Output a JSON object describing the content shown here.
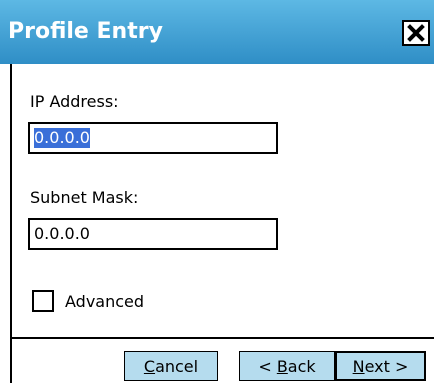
{
  "window": {
    "title": "Profile Entry",
    "close_glyph": "✕"
  },
  "form": {
    "ip_label": "IP Address:",
    "ip_value": "0.0.0.0",
    "subnet_label": "Subnet Mask:",
    "subnet_value": "0.0.0.0",
    "advanced_label": "Advanced",
    "advanced_checked": false
  },
  "buttons": {
    "cancel": {
      "pre": "",
      "mnemonic": "C",
      "post": "ancel"
    },
    "back": {
      "pre": "< ",
      "mnemonic": "B",
      "post": "ack"
    },
    "next": {
      "pre": "",
      "mnemonic": "N",
      "post": "ext >"
    }
  },
  "colors": {
    "titlebar_top": "#5db8e4",
    "titlebar_bottom": "#2f8ec6",
    "button_face": "#b5dcee",
    "selection": "#3a6fd8"
  }
}
